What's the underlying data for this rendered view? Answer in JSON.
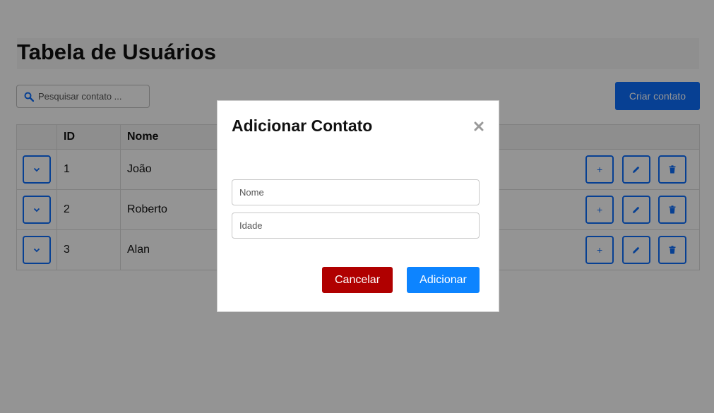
{
  "page": {
    "title": "Tabela de Usuários",
    "search_placeholder": "Pesquisar contato ...",
    "create_button": "Criar contato"
  },
  "table": {
    "headers": [
      "",
      "ID",
      "Nome",
      "",
      ""
    ],
    "rows": [
      {
        "id": "1",
        "name": "João"
      },
      {
        "id": "2",
        "name": "Roberto"
      },
      {
        "id": "3",
        "name": "Alan"
      }
    ],
    "action_icons": [
      "plus-icon",
      "pencil-icon",
      "trash-icon"
    ],
    "expand_icon": "chevron-down-icon",
    "add_label": "+"
  },
  "modal": {
    "title": "Adicionar Contato",
    "name_placeholder": "Nome",
    "age_placeholder": "Idade",
    "cancel_label": "Cancelar",
    "add_label": "Adicionar"
  },
  "colors": {
    "primary": "#0d6efd",
    "danger": "#b00000",
    "add": "#0d84ff"
  }
}
